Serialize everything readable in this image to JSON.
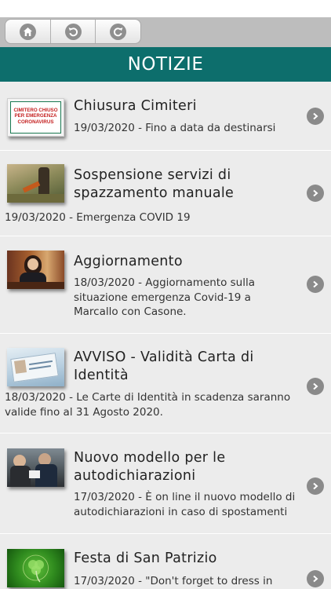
{
  "toolbar": {
    "home_icon": "home-icon",
    "back_icon": "back-icon",
    "refresh_icon": "refresh-icon"
  },
  "header": {
    "title": "NOTIZIE"
  },
  "news": [
    {
      "title": "Chiusura Cimiteri",
      "meta": "19/03/2020 - Fino a data da destinarsi",
      "thumb_text": [
        "CIMITERO CHIUSO",
        "PER EMERGENZA",
        "CORONAVIRUS"
      ],
      "thumb_icon": "sign-thumbnail"
    },
    {
      "title": "Sospensione servizi di spazzamento manuale",
      "meta": "19/03/2020 - Emergenza COVID 19",
      "thumb_icon": "street-sweeper-thumbnail"
    },
    {
      "title": "Aggiornamento",
      "meta": "18/03/2020 - Aggiornamento sulla situazione emergenza Covid-19 a Marcallo con Casone.",
      "thumb_icon": "mayor-photo-thumbnail"
    },
    {
      "title": "AVVISO - Validità Carta di Identità",
      "meta": "18/03/2020 - Le Carte di Identità in scadenza saranno valide fino al 31 Agosto 2020.",
      "thumb_icon": "id-card-thumbnail"
    },
    {
      "title": "Nuovo modello per le autodichiarazioni",
      "meta": "17/03/2020 - È on line il nuovo modello di autodichiarazioni in caso di spostamenti",
      "thumb_icon": "police-check-thumbnail"
    },
    {
      "title": "Festa di San Patrizio",
      "meta": "17/03/2020 - \"Don't forget to dress in",
      "thumb_icon": "shamrock-thumbnail"
    }
  ],
  "colors": {
    "header_bg": "#0d6e6c",
    "toolbar_bg": "#bdbdbd",
    "list_bg": "#ececec",
    "chevron": "#8a8a8a"
  }
}
